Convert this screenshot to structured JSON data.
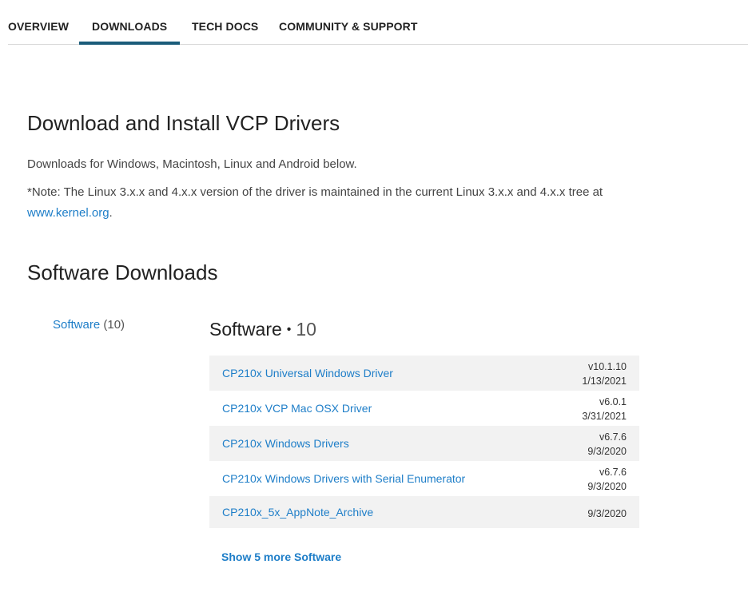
{
  "nav": {
    "tabs": [
      {
        "label": "OVERVIEW"
      },
      {
        "label": "DOWNLOADS"
      },
      {
        "label": "TECH DOCS"
      },
      {
        "label": "COMMUNITY & SUPPORT"
      }
    ],
    "active_tab": "DOWNLOADS"
  },
  "main": {
    "title": "Download and Install VCP Drivers",
    "intro": "Downloads for Windows, Macintosh, Linux and Android below.",
    "note": "*Note: The Linux 3.x.x and 4.x.x version of the driver is maintained in the current Linux 3.x.x and 4.x.x tree at",
    "note_link": "www.kernel.org",
    "note_end": "."
  },
  "downloads": {
    "heading": "Software Downloads",
    "filter": {
      "label": "Software",
      "count": "(10)"
    },
    "section_title": "Software",
    "section_separator": "•",
    "section_count": "10",
    "items": [
      {
        "name": "CP210x Universal Windows Driver",
        "version": "v10.1.10",
        "date": "1/13/2021"
      },
      {
        "name": "CP210x VCP Mac OSX Driver",
        "version": "v6.0.1",
        "date": "3/31/2021"
      },
      {
        "name": "CP210x Windows Drivers",
        "version": "v6.7.6",
        "date": "9/3/2020"
      },
      {
        "name": "CP210x Windows Drivers with Serial Enumerator",
        "version": "v6.7.6",
        "date": "9/3/2020"
      },
      {
        "name": "CP210x_5x_AppNote_Archive",
        "version": "",
        "date": "9/3/2020"
      }
    ],
    "show_more": "Show 5 more Software"
  },
  "colors": {
    "link": "#1e7ec8",
    "active_tab_underline": "#1a5c7a",
    "row_shade": "#f2f2f2"
  }
}
